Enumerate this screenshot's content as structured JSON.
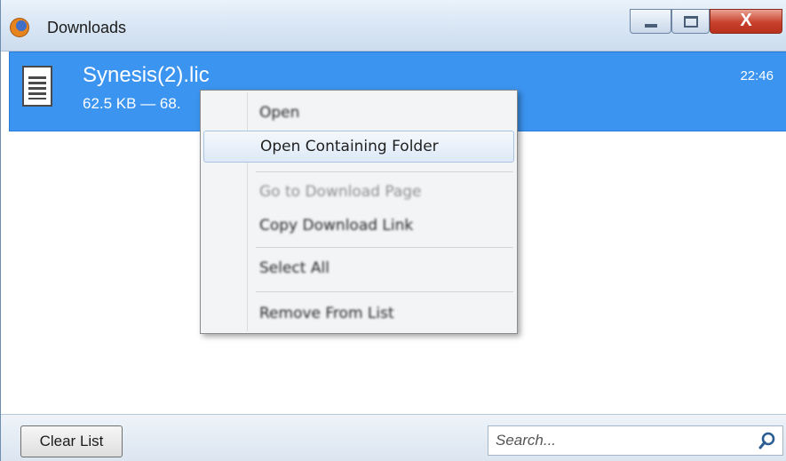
{
  "window": {
    "title": "Downloads"
  },
  "controls": {
    "close_glyph": "X"
  },
  "download": {
    "filename": "Synesis(2).lic",
    "meta": "62.5 KB — 68.",
    "time": "22:46"
  },
  "context_menu": {
    "items": [
      {
        "label": "Open",
        "state": "enabled-blurred"
      },
      {
        "label": "Open Containing Folder",
        "state": "highlighted"
      },
      {
        "label": "Go to Download Page",
        "state": "disabled"
      },
      {
        "label": "Copy Download Link",
        "state": "enabled-blurred"
      },
      {
        "label": "Select All",
        "state": "enabled-blurred"
      },
      {
        "label": "Remove From List",
        "state": "enabled-blurred"
      }
    ]
  },
  "bottombar": {
    "clear_label": "Clear List",
    "search_placeholder": "Search..."
  },
  "icons": {
    "app": "firefox-icon",
    "file": "document-file-icon",
    "search": "search-icon",
    "minimize": "minimize-icon",
    "maximize": "maximize-icon",
    "close": "close-icon"
  },
  "colors": {
    "selection": "#3b94f0",
    "close_button": "#c8412c",
    "menu_highlight": "#dde9f7"
  }
}
